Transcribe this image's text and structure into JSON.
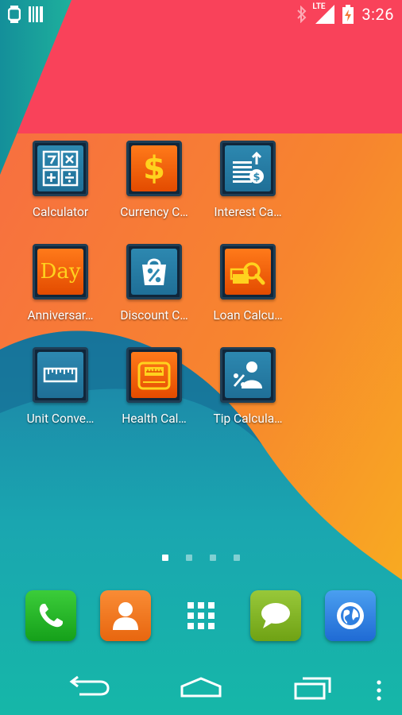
{
  "status_bar": {
    "time": "3:26",
    "network_type": "LTE",
    "icons": [
      "smartwatch-icon",
      "barcode-icon",
      "bluetooth-icon",
      "signal-icon",
      "battery-charging-icon"
    ]
  },
  "apps": [
    {
      "label": "Calculator",
      "icon": "calculator-icon"
    },
    {
      "label": "Currency C…",
      "icon": "dollar-icon"
    },
    {
      "label": "Interest Ca…",
      "icon": "interest-icon"
    },
    {
      "label": "Anniversar…",
      "icon": "day-icon",
      "icon_text": "Day"
    },
    {
      "label": "Discount C…",
      "icon": "discount-bag-icon"
    },
    {
      "label": "Loan Calcu…",
      "icon": "loan-search-icon"
    },
    {
      "label": "Unit Conve…",
      "icon": "ruler-icon"
    },
    {
      "label": "Health Cal…",
      "icon": "scale-icon"
    },
    {
      "label": "Tip Calcula…",
      "icon": "tip-person-icon"
    }
  ],
  "home_pages": {
    "count": 4,
    "active_index": 0
  },
  "dock": [
    {
      "name": "phone",
      "icon": "phone-icon",
      "color": "#22b02a"
    },
    {
      "name": "contacts",
      "icon": "contacts-icon",
      "color": "#f0781e"
    },
    {
      "name": "app-drawer",
      "icon": "grid-icon"
    },
    {
      "name": "messaging",
      "icon": "chat-icon",
      "color": "#7db41e"
    },
    {
      "name": "browser",
      "icon": "globe-icon",
      "color": "#2a7fe0"
    }
  ],
  "navigation": [
    "back-icon",
    "home-icon",
    "recents-icon",
    "overflow-menu-icon"
  ],
  "colors": {
    "wallpaper_red": "#f9425a",
    "wallpaper_orange": "#f7852e",
    "wallpaper_yellow": "#f7b51c",
    "wallpaper_teal": "#1aa6a6",
    "icon_frame": "#1f3e55",
    "icon_blue": "#2d88b0",
    "icon_orange": "#f25c05",
    "icon_yellow": "#ffd21e"
  }
}
